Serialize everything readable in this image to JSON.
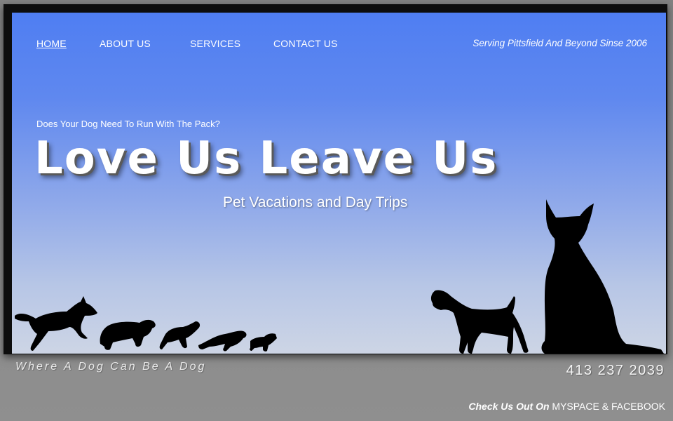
{
  "nav": {
    "items": [
      {
        "label": "HOME",
        "active": true
      },
      {
        "label": "ABOUT US",
        "active": false
      },
      {
        "label": "SERVICES",
        "active": false
      },
      {
        "label": "CONTACT US",
        "active": false
      }
    ]
  },
  "header": {
    "tagline": "Serving Pittsfield And Beyond Sinse 2006"
  },
  "hero": {
    "question": "Does Your Dog Need To Run With The Pack?",
    "logo_text": "Love Us Leave Us",
    "subtitle": "Pet Vacations and Day Trips"
  },
  "footer": {
    "tagline": "Where A Dog Can Be A Dog",
    "phone": "413 237 2039",
    "social_prefix": "Check Us Out On",
    "myspace_label": "MYSPACE",
    "separator": "&",
    "facebook_label": "FACEBOOK"
  },
  "colors": {
    "sky_top": "#4f7ef2",
    "sky_bottom": "#cdd5e5",
    "frame": "#0d0d0d",
    "background": "#8a8a8a"
  }
}
